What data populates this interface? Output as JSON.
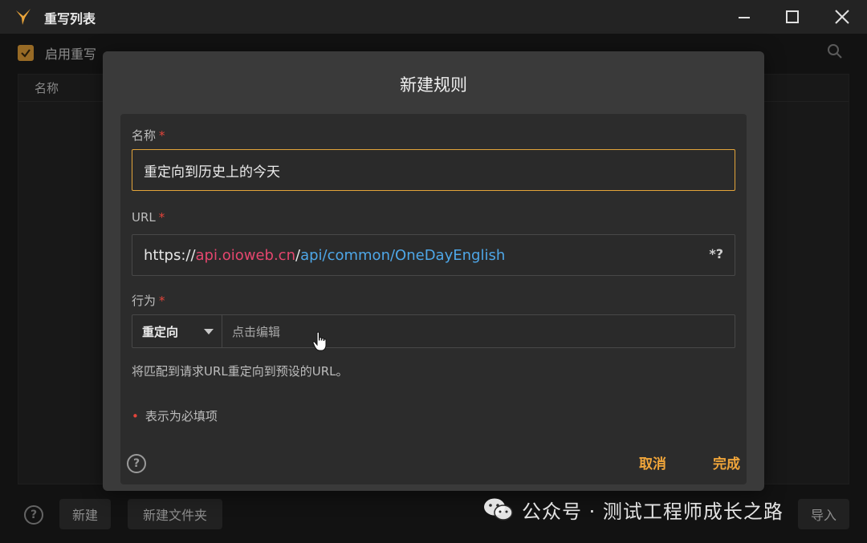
{
  "window": {
    "title": "重写列表",
    "enable_label": "启用重写",
    "enable_checked": true,
    "table_header_name": "名称",
    "bottom_help": "?",
    "new_button": "新建",
    "new_folder_button": "新建文件夹",
    "right_button": "导入"
  },
  "dialog": {
    "title": "新建规则",
    "name_label": "名称",
    "required_mark": "*",
    "name_value": "重定向到历史上的今天",
    "url_label": "URL",
    "url_proto": "https://",
    "url_host": "api.oioweb.cn",
    "url_slash": "/",
    "url_path": "api/common/OneDayEnglish",
    "regex_toggle": "*?",
    "action_label": "行为",
    "action_selected": "重定向",
    "action_edit_placeholder": "点击编辑",
    "description": "将匹配到请求URL重定向到预设的URL。",
    "required_note_mark": "•",
    "required_note": "表示为必填项",
    "help": "?",
    "cancel_button": "取消",
    "done_button": "完成"
  },
  "watermark": {
    "text": "公众号 · 测试工程师成长之路"
  },
  "colors": {
    "accent": "#e9a43a",
    "required": "#e3443a",
    "url_host": "#e5466e",
    "url_path": "#4ea7e8"
  }
}
